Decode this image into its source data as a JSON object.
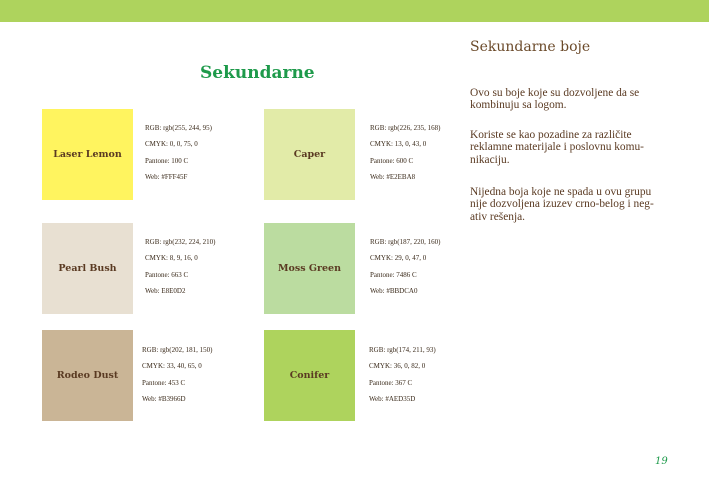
{
  "colors": {
    "top_bar": "#aed35d",
    "heading_green": "#1e9a4b",
    "text_brown": "#5a3a22"
  },
  "section_title": "Sekundarne",
  "swatches": [
    {
      "name": "Laser Lemon",
      "color": "#fff45f",
      "rgb": "RGB:  rgb(255, 244, 95)",
      "cmyk": "CMYK:  0, 0, 75, 0",
      "pantone": "Pantone: 100 C",
      "web": "Web: #FFF45F"
    },
    {
      "name": "Caper",
      "color": "#e2eba8",
      "rgb": "RGB:  rgb(226, 235, 168)",
      "cmyk": "CMYK: 13, 0, 43, 0",
      "pantone": "Pantone: 600 C",
      "web": "Web: #E2EBA8"
    },
    {
      "name": "Pearl Bush",
      "color": "#e8e0d2",
      "rgb": "RGB:  rgb(232, 224, 210)",
      "cmyk": "CMYK: 8, 9, 16, 0",
      "pantone": "Pantone: 663 C",
      "web": "Web: E8E0D2"
    },
    {
      "name": "Moss Green",
      "color": "#bbdca0",
      "rgb": "RGB:  rgb(187, 220, 160)",
      "cmyk": "CMYK:  29, 0, 47, 0",
      "pantone": "Pantone: 7486 C",
      "web": "Web: #BBDCA0"
    },
    {
      "name": "Rodeo Dust",
      "color": "#cab596",
      "rgb": "RGB: rgb(202, 181, 150)",
      "cmyk": "CMYK: 33, 40, 65, 0",
      "pantone": "Pantone: 453  C",
      "web": "Web: #B3966D"
    },
    {
      "name": "Conifer",
      "color": "#aed35d",
      "rgb": "RGB: rgb(174, 211, 93)",
      "cmyk": "CMYK:  36, 0, 82, 0",
      "pantone": "Pantone: 367 C",
      "web": "Web: #AED35D"
    }
  ],
  "right": {
    "title": "Sekundarne boje",
    "p1": "Ovo su boje koje su dozvoljene da se\nkombinuju sa logom.",
    "p2": "Koriste se kao pozadine za različite\nreklamne materijale i poslovnu komu-\nnikaciju.",
    "p3": "Nijedna boja koje ne spada u ovu grupu\nnije dozvoljena izuzev crno-belog i neg-\nativ rešenja."
  },
  "page_number": "19"
}
